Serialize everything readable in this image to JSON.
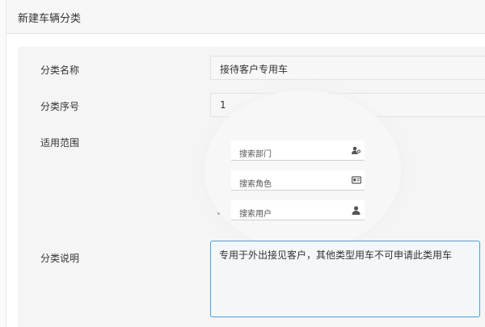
{
  "header": {
    "title": "新建车辆分类"
  },
  "form": {
    "name_label": "分类名称",
    "name_value": "接待客户专用车",
    "order_label": "分类序号",
    "order_value": "1",
    "scope_label": "适用范围",
    "desc_label": "分类说明",
    "desc_value": "专用于外出接见客户，其他类型用车不可申请此类用车"
  },
  "scope_search": [
    {
      "placeholder": "搜索部门",
      "icon": "department-icon"
    },
    {
      "placeholder": "搜索角色",
      "icon": "role-card-icon"
    },
    {
      "placeholder": "搜索用户",
      "icon": "user-icon"
    }
  ]
}
